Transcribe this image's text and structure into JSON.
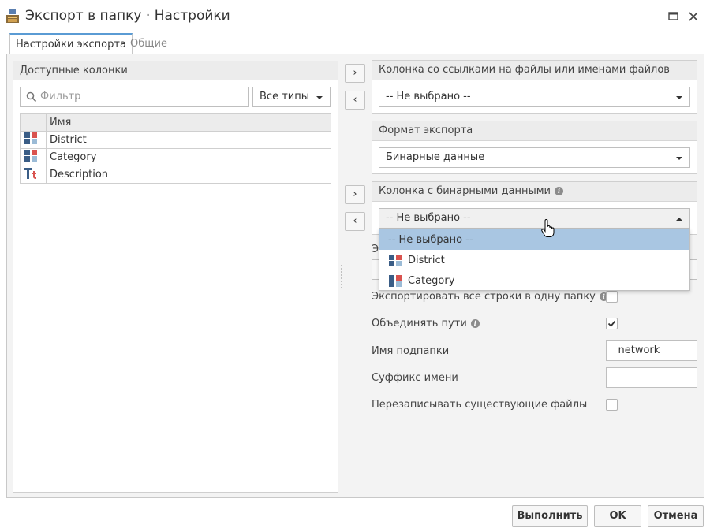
{
  "window": {
    "title": "Экспорт в папку · Настройки",
    "app_icon": "export-folder-icon",
    "maximize_icon": "maximize-icon",
    "close_icon": "close-icon"
  },
  "tabs": [
    {
      "label": "Настройки экспорта",
      "active": true
    },
    {
      "label": "Общие",
      "active": false
    }
  ],
  "available_columns": {
    "header": "Доступные колонки",
    "filter_placeholder": "Фильтр",
    "type_filter": "Все типы",
    "table_header": "Имя",
    "rows": [
      {
        "name": "District",
        "icon": "categorical-icon"
      },
      {
        "name": "Category",
        "icon": "categorical-icon"
      },
      {
        "name": "Description",
        "icon": "text-icon"
      }
    ]
  },
  "move_buttons": {
    "add": "›",
    "remove": "‹"
  },
  "file_column": {
    "header": "Колонка со ссылками на файлы или именами файлов",
    "value": "-- Не выбрано --"
  },
  "export_format": {
    "header": "Формат экспорта",
    "value": "Бинарные данные"
  },
  "binary_column": {
    "header": "Колонка с бинарными данными",
    "value": "-- Не выбрано --",
    "options": [
      {
        "label": "-- Не выбрано --",
        "icon": "",
        "selected": true
      },
      {
        "label": "District",
        "icon": "categorical-icon",
        "selected": false
      },
      {
        "label": "Category",
        "icon": "categorical-icon",
        "selected": false
      }
    ]
  },
  "options": {
    "partial_label": "Э",
    "export_all_rows_label": "Экспортировать все строки в одну папку",
    "export_all_rows_checked": false,
    "merge_paths_label": "Объединять пути",
    "merge_paths_checked": true,
    "subfolder_label": "Имя подпапки",
    "subfolder_value": "_network",
    "suffix_label": "Суффикс имени",
    "suffix_value": "",
    "overwrite_label": "Перезаписывать существующие файлы",
    "overwrite_checked": false
  },
  "footer": {
    "run_label": "Выполнить",
    "ok_label": "OK",
    "cancel_label": "Отмена"
  },
  "colors": {
    "accent": "#5a9bd4",
    "dropdown_selected": "#a9c6e2",
    "panel_bg": "#f3f3f3"
  }
}
